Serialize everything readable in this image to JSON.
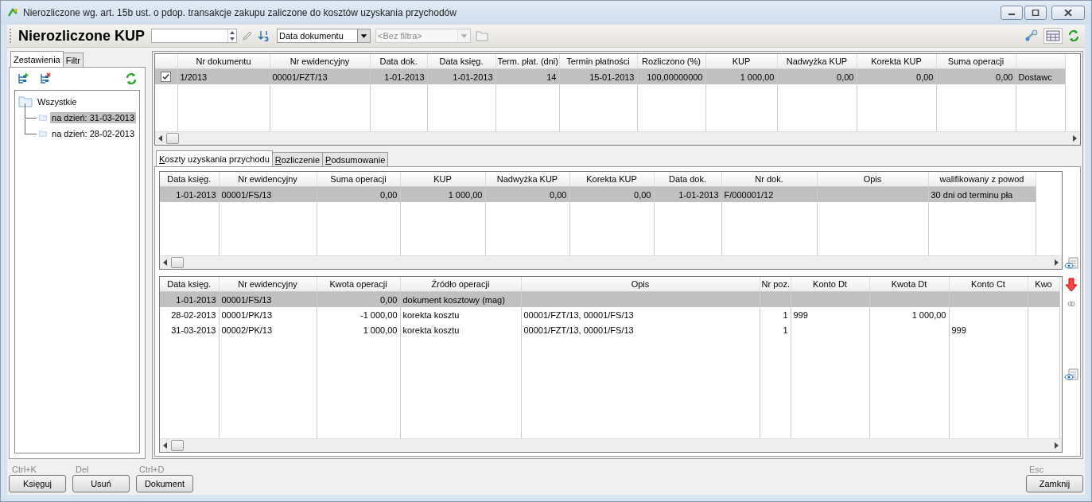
{
  "window": {
    "title": "Nierozliczone wg. art. 15b ust. o pdop. transakcje zakupu zaliczone do kosztów uzyskania przychodów"
  },
  "toolbar": {
    "title": "Nierozliczone KUP",
    "sort_field": {
      "value": "Data dokumentu"
    },
    "filter_field": {
      "placeholder": "<Bez filtra>",
      "disabled": true
    }
  },
  "left_tabs": [
    {
      "label": "Zestawienia",
      "selected": true
    },
    {
      "label": "Filtr",
      "selected": false
    }
  ],
  "tree": [
    {
      "label": "Wszystkie",
      "selected": false,
      "children": [
        {
          "label": "na dzień: 31-03-2013",
          "selected": true
        },
        {
          "label": "na dzień: 28-02-2013",
          "selected": false
        }
      ]
    }
  ],
  "documents_table": {
    "columns": [
      "Nr dokumentu",
      "Nr ewidencyjny",
      "Data dok.",
      "Data księg.",
      "Term. płat. (dni)",
      "Termin płatności",
      "Rozliczono (%)",
      "KUP",
      "Nadwyżka KUP",
      "Korekta KUP",
      "Suma operacji"
    ],
    "rows": [
      {
        "checked": true,
        "selected": true,
        "cells": [
          "1/2013",
          "00001/FZT/13",
          "1-01-2013",
          "1-01-2013",
          "14",
          "15-01-2013",
          "100,00000000",
          "1 000,00",
          "0,00",
          "0,00",
          "0,00",
          "Dostawc"
        ]
      }
    ]
  },
  "detail_tabs": [
    {
      "label": "Koszty uzyskania przychodu",
      "selected": true
    },
    {
      "label": "Rozliczenie",
      "selected": false
    },
    {
      "label": "Podsumowanie",
      "selected": false
    }
  ],
  "costs_table": {
    "columns": [
      "Data księg.",
      "Nr ewidencyjny",
      "Suma operacji",
      "KUP",
      "Nadwyżka KUP",
      "Korekta KUP",
      "Data dok.",
      "Nr dok.",
      "Opis",
      "walifikowany z powod"
    ],
    "rows": [
      {
        "selected": true,
        "cells": [
          "1-01-2013",
          "00001/FS/13",
          "0,00",
          "1 000,00",
          "0,00",
          "0,00",
          "1-01-2013",
          "F/000001/12",
          "",
          "30 dni od terminu pła"
        ]
      }
    ]
  },
  "operations_table": {
    "columns": [
      "Data księg.",
      "Nr ewidencyjny",
      "Kwota operacji",
      "Źródło operacji",
      "Opis",
      "Nr poz.",
      "Konto Dt",
      "Kwota Dt",
      "Konto Ct",
      "Kwo"
    ],
    "rows": [
      {
        "selected": true,
        "cells": [
          "1-01-2013",
          "00001/FS/13",
          "0,00",
          "dokument kosztowy (mag)",
          "",
          "",
          "",
          "",
          "",
          ""
        ]
      },
      {
        "selected": false,
        "cells": [
          "28-02-2013",
          "00001/PK/13",
          "-1 000,00",
          "korekta kosztu",
          "00001/FZT/13, 00001/FS/13",
          "1",
          "999",
          "1 000,00",
          "",
          ""
        ]
      },
      {
        "selected": false,
        "cells": [
          "31-03-2013",
          "00002/PK/13",
          "1 000,00",
          "korekta kosztu",
          "00001/FZT/13, 00001/FS/13",
          "1",
          "",
          "",
          "999",
          ""
        ]
      }
    ]
  },
  "buttons": [
    {
      "shortcut": "Ctrl+K",
      "label": "Księguj"
    },
    {
      "shortcut": "Del",
      "label": "Usuń"
    },
    {
      "shortcut": "Ctrl+D",
      "label": "Dokument"
    }
  ],
  "close_button": {
    "shortcut": "Esc",
    "label": "Zamknij"
  }
}
